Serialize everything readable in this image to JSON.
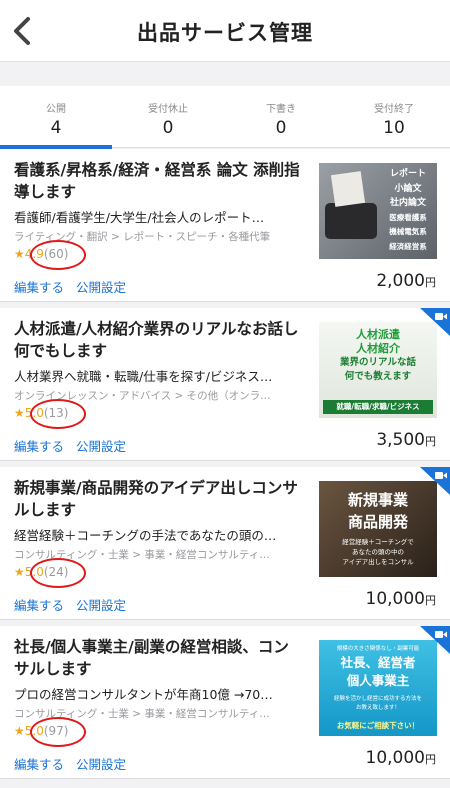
{
  "header": {
    "title": "出品サービス管理"
  },
  "tabs": [
    {
      "label": "公開",
      "count": "4"
    },
    {
      "label": "受付休止",
      "count": "0"
    },
    {
      "label": "下書き",
      "count": "0"
    },
    {
      "label": "受付終了",
      "count": "10"
    }
  ],
  "services": [
    {
      "title": "看護系/昇格系/経済・経営系 論文 添削指導します",
      "subtitle": "看護師/看護学生/大学生/社会人のレポート…",
      "category": "ライティング・翻訳 > レポート・スピーチ・各種代筆",
      "star": "★",
      "score": "4.9",
      "reviews": "(60)",
      "edit_label": "編集する",
      "publish_label": "公開設定",
      "price": "2,000",
      "currency": "円",
      "thumb_lines": [
        "レポート",
        "小論文",
        "社内論文",
        "医療看護系",
        "機械電気系",
        "経済経営系"
      ]
    },
    {
      "title": "人材派遣/人材紹介業界のリアルなお話し何でもします",
      "subtitle": "人材業界へ就職・転職/仕事を探す/ビジネス…",
      "category": "オンラインレッスン・アドバイス > その他（オンラ…",
      "star": "★",
      "score": "5.0",
      "reviews": "(13)",
      "edit_label": "編集する",
      "publish_label": "公開設定",
      "price": "3,500",
      "currency": "円",
      "thumb_lines": [
        "人材派遣",
        "人材紹介",
        "業界のリアルな話",
        "何でも教えます",
        "就職/転職/求職/ビジネス"
      ]
    },
    {
      "title": "新規事業/商品開発のアイデア出しコンサルします",
      "subtitle": "経営経験＋コーチングの手法であなたの頭の…",
      "category": "コンサルティング・士業 > 事業・経営コンサルティ…",
      "star": "★",
      "score": "5.0",
      "reviews": "(24)",
      "edit_label": "編集する",
      "publish_label": "公開設定",
      "price": "10,000",
      "currency": "円",
      "thumb_lines": [
        "新規事業",
        "商品開発",
        "経営経験＋コーチングで",
        "あなたの頭の中の",
        "アイデア出しをコンサル"
      ]
    },
    {
      "title": "社長/個人事業主/副業の経営相談、コンサルします",
      "subtitle": "プロの経営コンサルタントが年商10億 →70…",
      "category": "コンサルティング・士業 > 事業・経営コンサルティ…",
      "star": "★",
      "score": "5.0",
      "reviews": "(97)",
      "edit_label": "編集する",
      "publish_label": "公開設定",
      "price": "10,000",
      "currency": "円",
      "thumb_lines": [
        "規模の大きさ関係なし・副業可能",
        "社長、経営者",
        "個人事業主",
        "経験を活かし経営に成功する方法を",
        "お教え致します！",
        "お気軽にご相談下さい！"
      ]
    }
  ],
  "colors": {
    "accent": "#1a73d6",
    "star": "#f0a51a",
    "highlight_circle": "#e01818"
  }
}
